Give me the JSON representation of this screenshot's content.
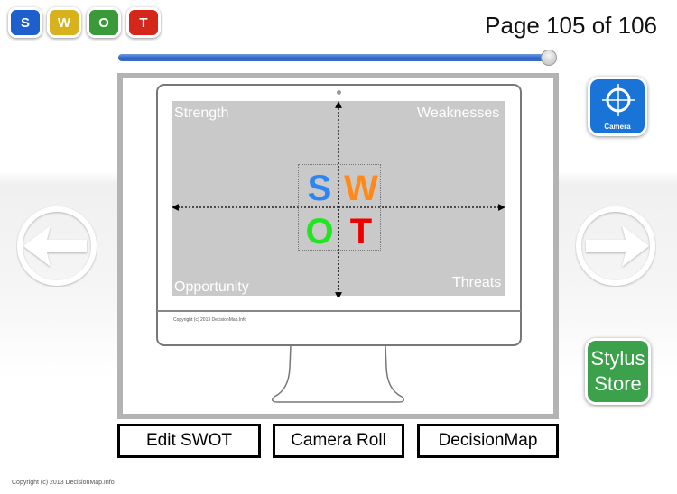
{
  "logo": {
    "letters": [
      {
        "label": "S",
        "color": "#1f5fcc"
      },
      {
        "label": "W",
        "color": "#d8b21c"
      },
      {
        "label": "O",
        "color": "#3a9a3a"
      },
      {
        "label": "T",
        "color": "#d4261a"
      }
    ]
  },
  "pager": {
    "label": "Page 105 of 106",
    "current_page": 105,
    "total_pages": 106,
    "progress_fraction": 0.99
  },
  "slide": {
    "quadrants": {
      "top_left": "Strength",
      "top_right": "Weaknesses",
      "bottom_left": "Opportunity",
      "bottom_right": "Threats"
    },
    "swot_letters": [
      {
        "label": "S",
        "color": "#2d86f0"
      },
      {
        "label": "W",
        "color": "#ff8a1a"
      },
      {
        "label": "O",
        "color": "#22e522"
      },
      {
        "label": "T",
        "color": "#ee0000"
      }
    ],
    "inner_copyright": "Copyright (c) 2013 DecisionMap.Info"
  },
  "navigation": {
    "prev_icon": "left-arrow-circle-icon",
    "next_icon": "right-arrow-circle-icon"
  },
  "side_buttons": {
    "camera": {
      "label": "Camera",
      "icon": "crosshair-icon",
      "color": "#1a73d6"
    },
    "stylus_store": {
      "line1": "Stylus",
      "line2": "Store",
      "color": "#3ba14a"
    }
  },
  "actions": {
    "edit_swot": "Edit SWOT",
    "camera_roll": "Camera Roll",
    "decision_map": "DecisionMap"
  },
  "footer": {
    "copyright": "Copyright (c) 2013 DecisionMap.Info"
  }
}
